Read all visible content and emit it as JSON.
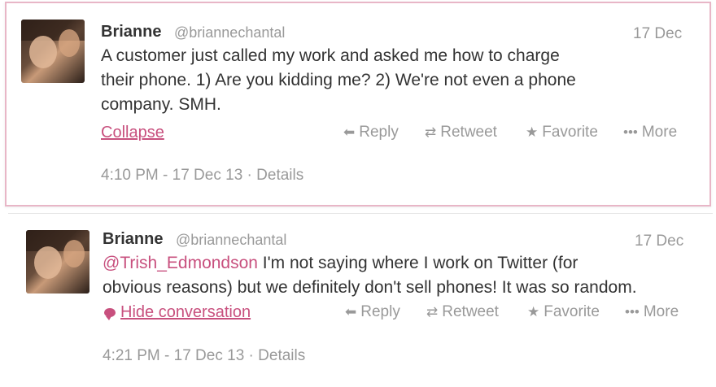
{
  "tweets": [
    {
      "name": "Brianne",
      "handle": "@briannechantal",
      "date": "17 Dec",
      "text_lines": [
        "A customer just called my work and asked me how to charge",
        "their phone. 1) Are you kidding me? 2) We're not even a phone",
        "company. SMH."
      ],
      "expand_label": "Collapse",
      "actions": {
        "reply": "Reply",
        "retweet": "Retweet",
        "favorite": "Favorite",
        "more": "More"
      },
      "timestamp": "4:10 PM - 17 Dec 13",
      "details": "Details"
    },
    {
      "name": "Brianne",
      "handle": "@briannechantal",
      "date": "17 Dec",
      "mention": "@Trish_Edmondson",
      "text_line1_rest": " I'm not saying where I  work on Twitter (for",
      "text_line2": "obvious reasons) but we definitely don't sell phones! It was so random.",
      "expand_label": "Hide conversation",
      "actions": {
        "reply": "Reply",
        "retweet": "Retweet",
        "favorite": "Favorite",
        "more": "More"
      },
      "timestamp": "4:21 PM - 17 Dec 13",
      "details": "Details"
    }
  ],
  "icons": {
    "reply": "reply-arrow",
    "retweet": "retweet-arrows",
    "favorite": "star",
    "more": "ellipsis",
    "conversation": "speech-bubble"
  },
  "colors": {
    "accent": "#c8507e",
    "muted": "#999999",
    "text": "#333333",
    "card_border": "#e8b6c7"
  }
}
